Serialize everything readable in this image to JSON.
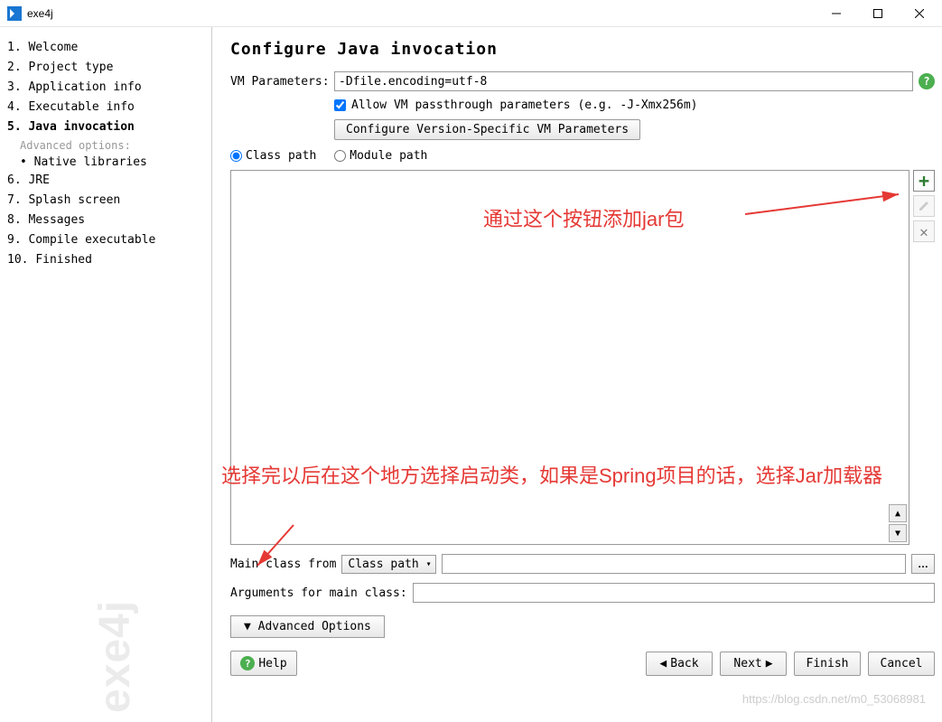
{
  "window": {
    "title": "exe4j"
  },
  "sidebar": {
    "items": [
      {
        "num": "1.",
        "label": "Welcome"
      },
      {
        "num": "2.",
        "label": "Project type"
      },
      {
        "num": "3.",
        "label": "Application info"
      },
      {
        "num": "4.",
        "label": "Executable info"
      },
      {
        "num": "5.",
        "label": "Java invocation",
        "bold": true
      },
      {
        "num": "6.",
        "label": "JRE"
      },
      {
        "num": "7.",
        "label": "Splash screen"
      },
      {
        "num": "8.",
        "label": "Messages"
      },
      {
        "num": "9.",
        "label": "Compile executable"
      },
      {
        "num": "10.",
        "label": "Finished"
      }
    ],
    "advanced_label": "Advanced options:",
    "advanced_item": "Native libraries",
    "watermark": "exe4j"
  },
  "content": {
    "title": "Configure Java invocation",
    "vm_label": "VM Parameters:",
    "vm_value": "-Dfile.encoding=utf-8",
    "allow_passthrough": "Allow VM passthrough parameters (e.g. -J-Xmx256m)",
    "config_version_btn": "Configure Version-Specific VM Parameters",
    "radio_classpath": "Class path",
    "radio_modulepath": "Module path",
    "main_class_label": "Main class from",
    "main_class_select": "Class path",
    "main_class_value": "",
    "args_label": "Arguments for main class:",
    "args_value": "",
    "advanced_btn": "Advanced Options",
    "help_btn": "Help",
    "back_btn": "Back",
    "next_btn": "Next",
    "finish_btn": "Finish",
    "cancel_btn": "Cancel"
  },
  "annotations": {
    "add_jar": "通过这个按钮添加jar包",
    "select_main": "选择完以后在这个地方选择启动类，如果是Spring项目的话，选择Jar加载器"
  },
  "url_watermark": "https://blog.csdn.net/m0_53068981"
}
